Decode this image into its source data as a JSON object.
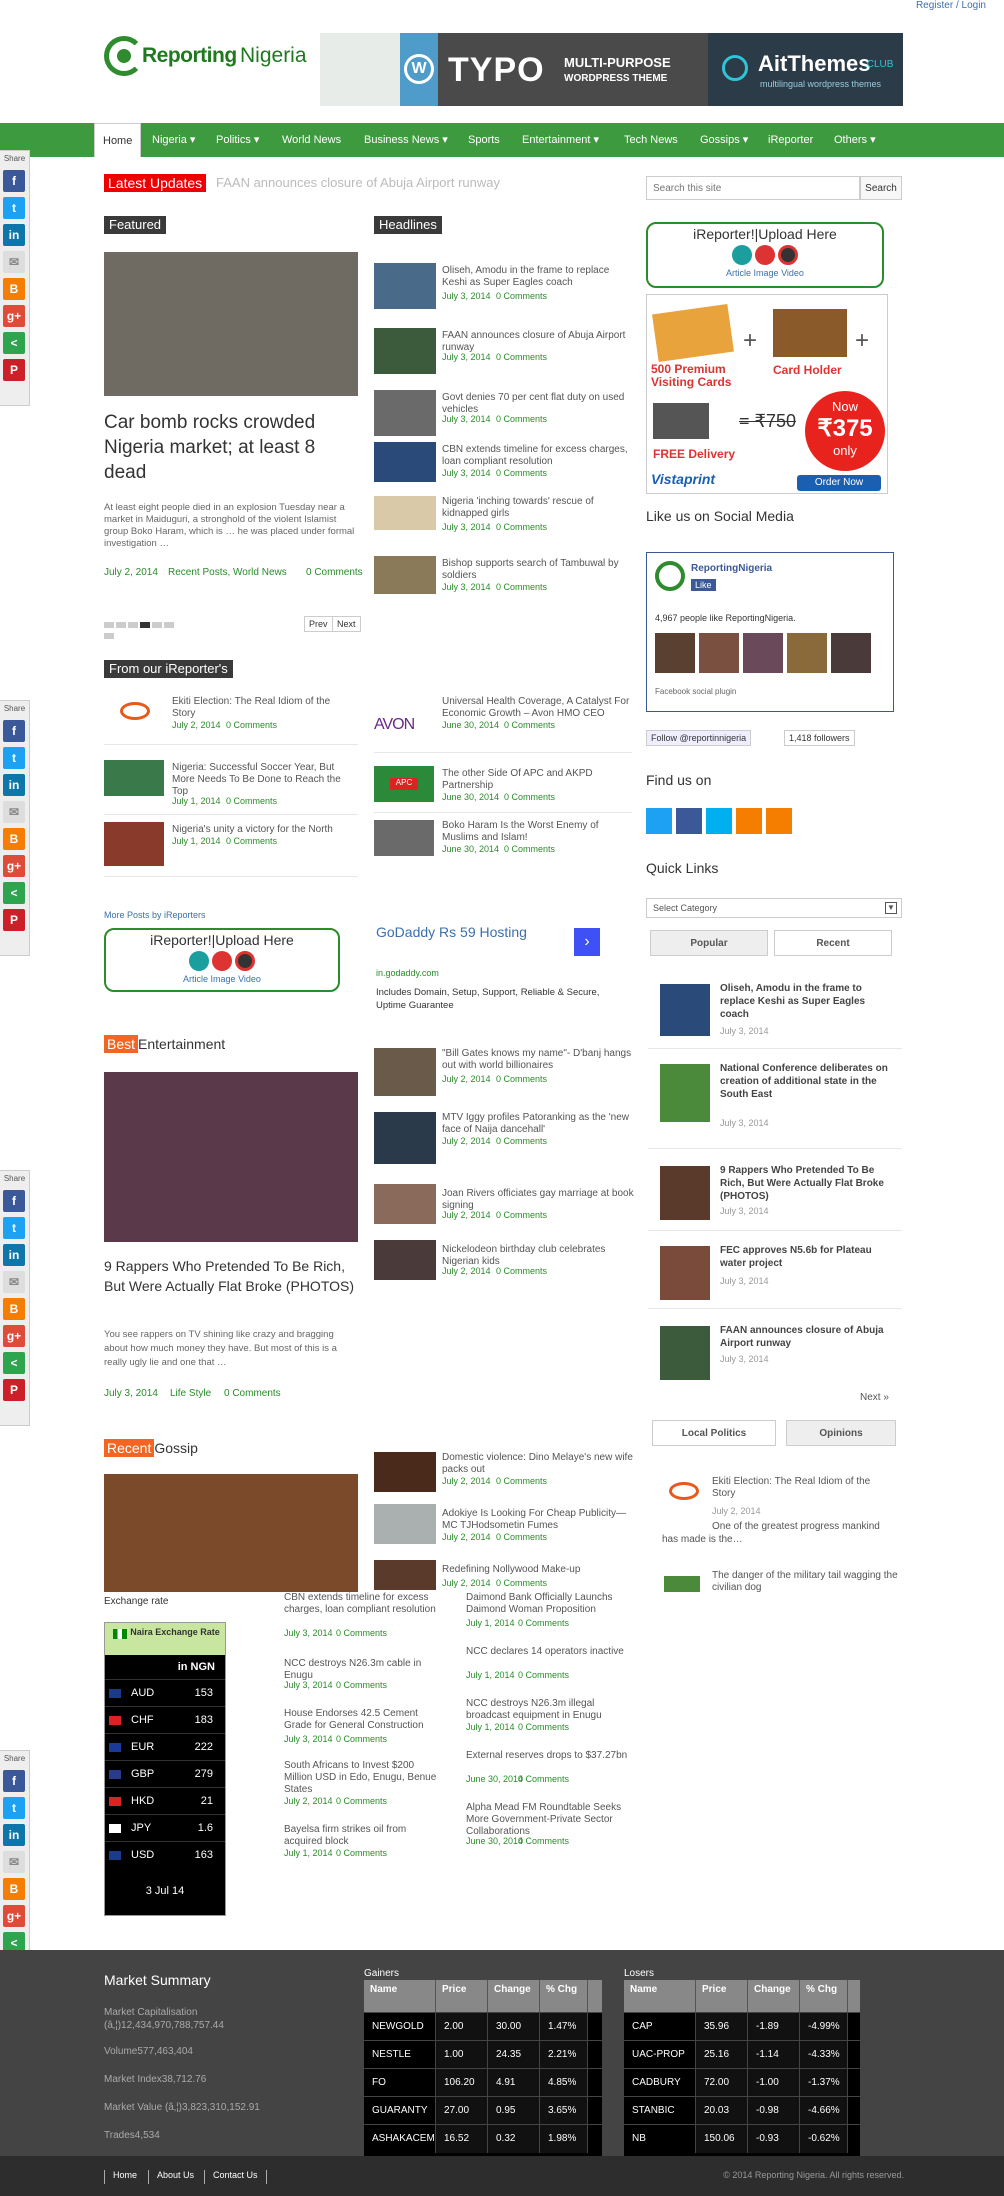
{
  "top": {
    "register": "Register / Login"
  },
  "logo": {
    "part1": "Reporting",
    "part2": "Nigeria"
  },
  "banner": {
    "theme": "TYPO",
    "theme_sub1": "MULTI-PURPOSE",
    "theme_sub2": "WORDPRESS THEME",
    "brand": "AitThemes",
    "brand_tld": ".CLUB",
    "brand_sub": "multilingual wordpress themes"
  },
  "nav": [
    "Home",
    "Nigeria ▾",
    "Politics ▾",
    "World News",
    "Business News ▾",
    "Sports",
    "Entertainment ▾",
    "Tech News",
    "Gossips ▾",
    "iReporter",
    "Others ▾"
  ],
  "share_label": "Share",
  "ticker": {
    "label": "Latest Updates",
    "text": "FAAN announces closure of Abuja Airport runway"
  },
  "search": {
    "placeholder": "Search this site",
    "button": "Search"
  },
  "featured": {
    "label": "Featured",
    "title": "Car bomb rocks crowded Nigeria market; at least 8 dead",
    "excerpt": "At least eight people died in an explosion Tuesday near a market in  Maiduguri, a stronghold of the violent Islamist group Boko Haram, which is … he was placed under formal investigation …",
    "date": "July 2, 2014",
    "cats": "Recent Posts, World News",
    "comments": "0 Comments",
    "prev": "Prev",
    "next": "Next"
  },
  "headlines": {
    "label": "Headlines",
    "items": [
      {
        "title": "Oliseh, Amodu in the frame to replace Keshi as Super Eagles coach",
        "date": "July 3, 2014",
        "comments": "0 Comments"
      },
      {
        "title": "FAAN announces closure of Abuja Airport runway",
        "date": "July 3, 2014",
        "comments": "0 Comments"
      },
      {
        "title": "Govt denies 70 per cent flat duty on used vehicles",
        "date": "July 3, 2014",
        "comments": "0 Comments"
      },
      {
        "title": "CBN extends timeline for excess charges, loan compliant resolution",
        "date": "July 3, 2014",
        "comments": "0 Comments"
      },
      {
        "title": "Nigeria 'inching towards' rescue of kidnapped girls",
        "date": "July 3, 2014",
        "comments": "0 Comments"
      },
      {
        "title": "Bishop supports search of Tambuwal by soldiers",
        "date": "July 3, 2014",
        "comments": "0 Comments"
      }
    ]
  },
  "ireporter": {
    "upload": "iReporter!|Upload Here",
    "links": "Article  Image  Video"
  },
  "ad": {
    "cards": "500 Premium Visiting Cards",
    "holder": "Card Holder",
    "delivery": "FREE Delivery",
    "old": "= ₹750",
    "now": "Now",
    "price": "₹375",
    "only": "only",
    "brand": "Vistaprint",
    "order": "Order Now"
  },
  "social": {
    "heading": "Like us on Social Media",
    "page": "ReportingNigeria",
    "like": "Like",
    "people": "4,967 people like ReportingNigeria.",
    "plugin": "Facebook social plugin",
    "follow": "Follow @reportinnigeria",
    "followers": "1,418 followers"
  },
  "findus": "Find us on",
  "quicklinks": {
    "heading": "Quick Links",
    "select": "Select Category",
    "tab1": "Popular",
    "tab2": "Recent",
    "items": [
      {
        "title": "Oliseh, Amodu in the frame to replace Keshi as Super Eagles coach",
        "date": "July 3, 2014"
      },
      {
        "title": "National Conference deliberates on creation of additional state in the South East",
        "date": "July 3, 2014"
      },
      {
        "title": "9 Rappers Who Pretended To Be Rich, But Were Actually Flat Broke (PHOTOS)",
        "date": "July 3, 2014"
      },
      {
        "title": "FEC approves N5.6b for Plateau water project",
        "date": "July 3, 2014"
      },
      {
        "title": "FAAN announces closure of Abuja Airport runway",
        "date": "July 3, 2014"
      }
    ],
    "next": "Next »",
    "tab3": "Local Politics",
    "tab4": "Opinions",
    "op1": "Ekiti Election: The Real Idiom of the Story",
    "op1date": "July 2, 2014",
    "op1ex": "One of the greatest progress mankind has made is the…",
    "op2": "The danger of the military tail wagging the civilian dog"
  },
  "from_ireporters": {
    "label": "From our iReporter's",
    "left": [
      {
        "title": "Ekiti Election: The Real Idiom of the Story",
        "date": "July 2, 2014",
        "comments": "0 Comments"
      },
      {
        "title": "Nigeria: Successful Soccer Year, But More Needs To Be Done to Reach the Top",
        "date": "July 1, 2014",
        "comments": "0 Comments"
      },
      {
        "title": "Nigeria's unity a victory for the North",
        "date": "July 1, 2014",
        "comments": "0 Comments"
      }
    ],
    "right": [
      {
        "title": "Universal Health Coverage, A Catalyst For Economic Growth – Avon HMO CEO",
        "date": "June 30, 2014",
        "comments": "0 Comments"
      },
      {
        "title": "The other Side Of APC and AKPD Partnership",
        "date": "June 30, 2014",
        "comments": "0 Comments"
      },
      {
        "title": "Boko Haram Is the Worst Enemy of Muslims and Islam!",
        "date": "June 30, 2014",
        "comments": "0 Comments"
      }
    ],
    "more": "More Posts by iReporters"
  },
  "godaddy": {
    "title": "GoDaddy Rs 59 Hosting",
    "url": "in.godaddy.com",
    "text": "Includes Domain, Setup, Support, Reliable & Secure, Uptime Guarantee"
  },
  "entertainment": {
    "label1": "Best",
    "label2": "Entertainment",
    "title": "9 Rappers Who Pretended To Be Rich, But Were Actually Flat Broke (PHOTOS)",
    "excerpt": "You see rappers on TV shining like crazy and bragging about how much money they have.  But most of this is a really ugly lie and one that …",
    "date": "July 3, 2014",
    "cat": "Life Style",
    "comments": "0 Comments",
    "items": [
      {
        "title": "\"Bill Gates knows my name\"- D'banj hangs out with world billionaires",
        "date": "July 2, 2014",
        "comments": "0 Comments"
      },
      {
        "title": "MTV Iggy profiles Patoranking as the 'new face of Naija dancehall'",
        "date": "July 2, 2014",
        "comments": "0 Comments"
      },
      {
        "title": "Joan Rivers officiates gay marriage at book signing",
        "date": "July 2, 2014",
        "comments": "0 Comments"
      },
      {
        "title": "Nickelodeon birthday club celebrates Nigerian kids",
        "date": "July 2, 2014",
        "comments": "0 Comments"
      }
    ]
  },
  "gossip": {
    "label1": "Recent",
    "label2": "Gossip",
    "items": [
      {
        "title": "Domestic violence: Dino Melaye's new wife packs out",
        "date": "July 2, 2014",
        "comments": "0 Comments"
      },
      {
        "title": "Adokiye Is Looking For Cheap Publicity—MC TJHodsometin Fumes",
        "date": "July 2, 2014",
        "comments": "0 Comments"
      },
      {
        "title": "Redefining Nollywood Make-up",
        "date": "July 2, 2014",
        "comments": "0 Comments"
      }
    ]
  },
  "exchange": {
    "label": "Exchange rate",
    "title": "Naira Exchange Rate",
    "unit": "in NGN",
    "rows": [
      [
        "AUD",
        "153"
      ],
      [
        "CHF",
        "183"
      ],
      [
        "EUR",
        "222"
      ],
      [
        "GBP",
        "279"
      ],
      [
        "HKD",
        "21"
      ],
      [
        "JPY",
        "1.6"
      ],
      [
        "USD",
        "163"
      ]
    ],
    "date": "3 Jul 14"
  },
  "business": {
    "col1": [
      {
        "title": "CBN extends timeline for excess charges, loan compliant resolution",
        "date": "July 3, 2014",
        "comments": "0 Comments"
      },
      {
        "title": "NCC destroys N26.3m cable in Enugu",
        "date": "July 3, 2014",
        "comments": "0 Comments"
      },
      {
        "title": "House Endorses 42.5 Cement Grade for General Construction",
        "date": "July 3, 2014",
        "comments": "0 Comments"
      },
      {
        "title": "South Africans to Invest $200 Million USD in Edo, Enugu, Benue States",
        "date": "July 2, 2014",
        "comments": "0 Comments"
      },
      {
        "title": "Bayelsa firm strikes oil from acquired block",
        "date": "July 1, 2014",
        "comments": "0 Comments"
      }
    ],
    "col2": [
      {
        "title": "Daimond Bank Officially Launchs Daimond Woman Proposition",
        "date": "July 1, 2014",
        "comments": "0 Comments"
      },
      {
        "title": "NCC declares 14 operators inactive",
        "date": "July 1, 2014",
        "comments": "0 Comments"
      },
      {
        "title": "NCC destroys N26.3m illegal broadcast equipment in Enugu",
        "date": "July 1, 2014",
        "comments": "0 Comments"
      },
      {
        "title": "External reserves drops to $37.27bn",
        "date": "June 30, 2014",
        "comments": "0 Comments"
      },
      {
        "title": "Alpha Mead FM Roundtable Seeks More Government-Private Sector Collaborations",
        "date": "June 30, 2014",
        "comments": "0 Comments"
      }
    ]
  },
  "market": {
    "heading": "Market Summary",
    "lines": [
      "Market Capitalisation",
      "(â‚¦)12,434,970,788,757.44",
      "Volume577,463,404",
      "Market Index38,712.76",
      "Market Value (â‚¦)3,823,310,152.91",
      "Trades4,534"
    ],
    "gainers_label": "Gainers",
    "losers_label": "Losers",
    "cols": [
      "Name",
      "Price",
      "Change",
      "% Chg"
    ],
    "gainers": [
      [
        "NEWGOLD",
        "2.00",
        "30.00",
        "1.47%"
      ],
      [
        "NESTLE",
        "1.00",
        "24.35",
        "2.21%"
      ],
      [
        "FO",
        "106.20",
        "4.91",
        "4.85%"
      ],
      [
        "GUARANTY",
        "27.00",
        "0.95",
        "3.65%"
      ],
      [
        "ASHAKACEM",
        "16.52",
        "0.32",
        "1.98%"
      ]
    ],
    "losers": [
      [
        "CAP",
        "35.96",
        "-1.89",
        "-4.99%"
      ],
      [
        "UAC-PROP",
        "25.16",
        "-1.14",
        "-4.33%"
      ],
      [
        "CADBURY",
        "72.00",
        "-1.00",
        "-1.37%"
      ],
      [
        "STANBIC",
        "20.03",
        "-0.98",
        "-4.66%"
      ],
      [
        "NB",
        "150.06",
        "-0.93",
        "-0.62%"
      ]
    ]
  },
  "footer": {
    "links": [
      "Home",
      "About Us",
      "Contact Us"
    ],
    "copyright": "© 2014 Reporting Nigeria. All rights reserved."
  }
}
